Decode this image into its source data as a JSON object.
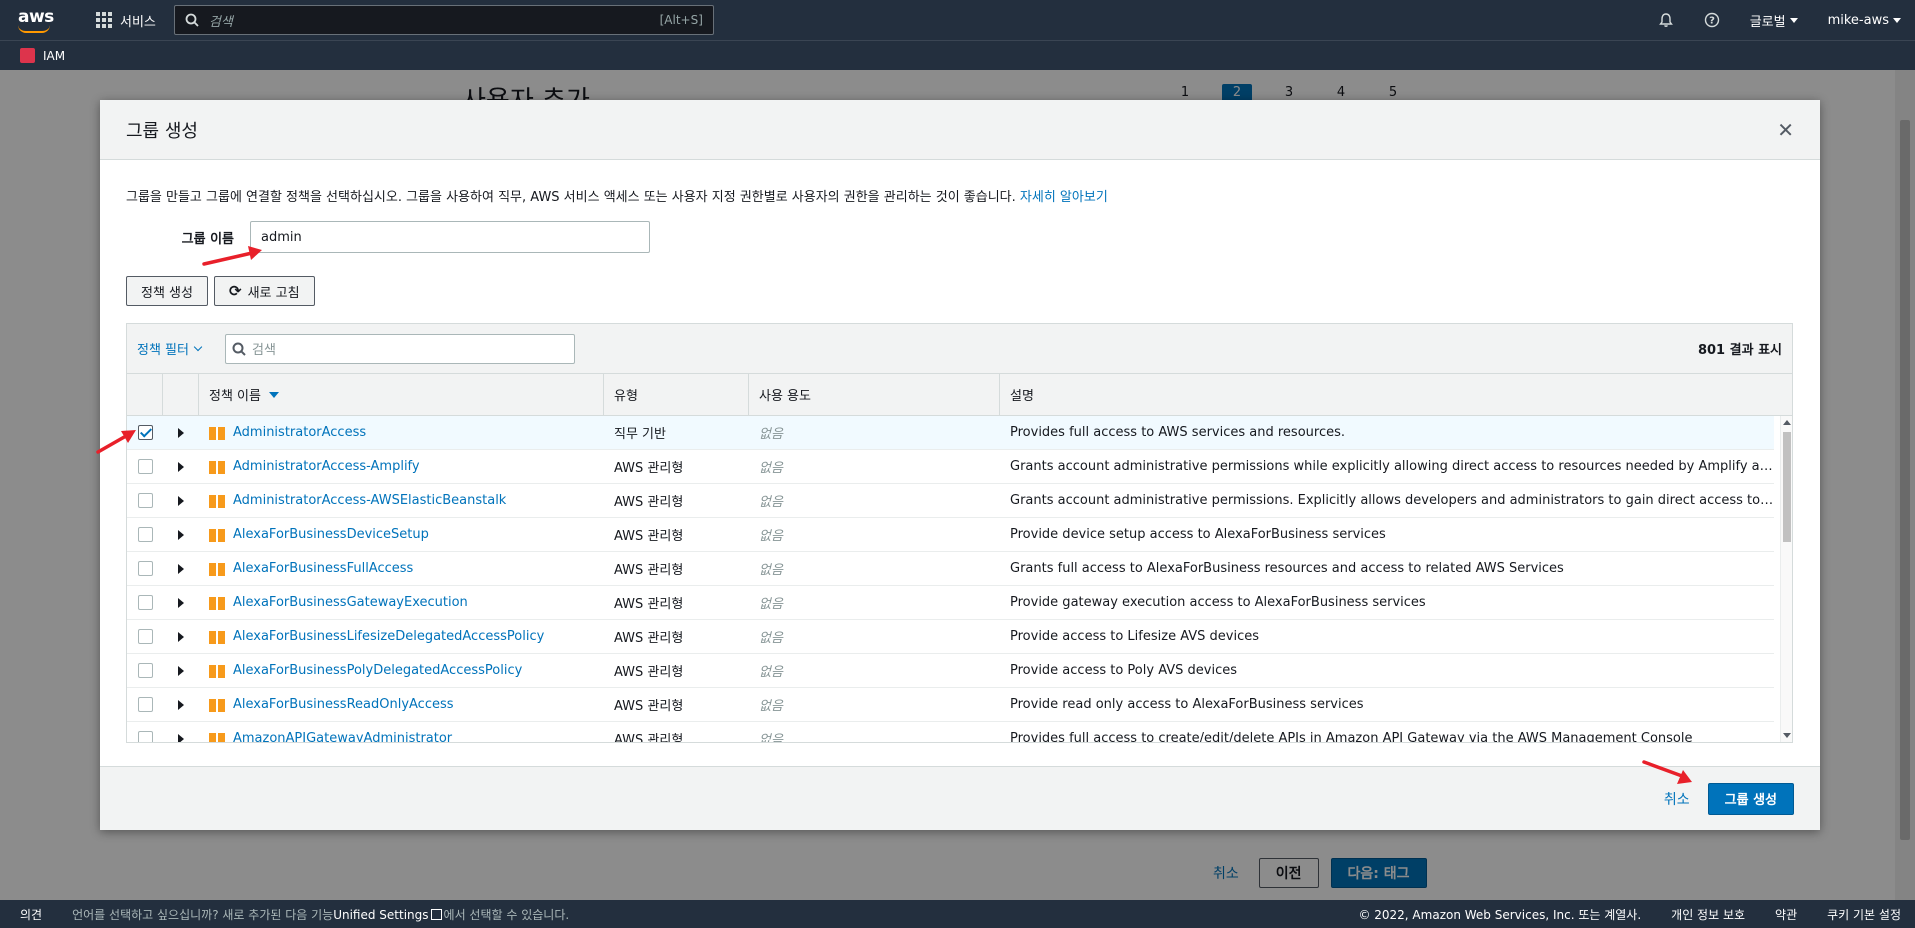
{
  "topnav": {
    "logo_text": "aws",
    "services_label": "서비스",
    "search_placeholder": "검색",
    "search_shortcut": "[Alt+S]",
    "region_label": "글로벌",
    "account_label": "mike-aws"
  },
  "subnav": {
    "service_name": "IAM"
  },
  "background": {
    "title": "사용자 추가",
    "steps": [
      "1",
      "2",
      "3",
      "4",
      "5"
    ],
    "active_step": "2",
    "cancel_label": "취소",
    "prev_label": "이전",
    "next_label": "다음: 태그"
  },
  "modal": {
    "title": "그룹 생성",
    "description": "그룹을 만들고 그룹에 연결할 정책을 선택하십시오. 그룹을 사용하여 직무, AWS 서비스 액세스 또는 사용자 지정 권한별로 사용자의 권한을 관리하는 것이 좋습니다.",
    "learn_more": "자세히 알아보기",
    "group_name_label": "그룹 이름",
    "group_name_value": "admin",
    "create_policy_label": "정책 생성",
    "refresh_label": "새로 고침",
    "filter_label": "정책 필터",
    "table_search_placeholder": "검색",
    "result_count": "801 결과 표시",
    "columns": {
      "name": "정책 이름",
      "type": "유형",
      "usage": "사용 용도",
      "description": "설명"
    },
    "rows": [
      {
        "name": "AdministratorAccess",
        "type": "직무 기반",
        "usage": "없음",
        "description": "Provides full access to AWS services and resources.",
        "checked": true
      },
      {
        "name": "AdministratorAccess-Amplify",
        "type": "AWS 관리형",
        "usage": "없음",
        "description": "Grants account administrative permissions while explicitly allowing direct access to resources needed by Amplify applications.",
        "checked": false
      },
      {
        "name": "AdministratorAccess-AWSElasticBeanstalk",
        "type": "AWS 관리형",
        "usage": "없음",
        "description": "Grants account administrative permissions. Explicitly allows developers and administrators to gain direct access to resources.",
        "checked": false
      },
      {
        "name": "AlexaForBusinessDeviceSetup",
        "type": "AWS 관리형",
        "usage": "없음",
        "description": "Provide device setup access to AlexaForBusiness services",
        "checked": false
      },
      {
        "name": "AlexaForBusinessFullAccess",
        "type": "AWS 관리형",
        "usage": "없음",
        "description": "Grants full access to AlexaForBusiness resources and access to related AWS Services",
        "checked": false
      },
      {
        "name": "AlexaForBusinessGatewayExecution",
        "type": "AWS 관리형",
        "usage": "없음",
        "description": "Provide gateway execution access to AlexaForBusiness services",
        "checked": false
      },
      {
        "name": "AlexaForBusinessLifesizeDelegatedAccessPolicy",
        "type": "AWS 관리형",
        "usage": "없음",
        "description": "Provide access to Lifesize AVS devices",
        "checked": false
      },
      {
        "name": "AlexaForBusinessPolyDelegatedAccessPolicy",
        "type": "AWS 관리형",
        "usage": "없음",
        "description": "Provide access to Poly AVS devices",
        "checked": false
      },
      {
        "name": "AlexaForBusinessReadOnlyAccess",
        "type": "AWS 관리형",
        "usage": "없음",
        "description": "Provide read only access to AlexaForBusiness services",
        "checked": false
      },
      {
        "name": "AmazonAPIGatewayAdministrator",
        "type": "AWS 관리형",
        "usage": "없음",
        "description": "Provides full access to create/edit/delete APIs in Amazon API Gateway via the AWS Management Console",
        "checked": false
      }
    ],
    "cancel_label": "취소",
    "create_group_label": "그룹 생성"
  },
  "footer": {
    "feedback": "의견",
    "message_before": "언어를 선택하고 싶으십니까? 새로 추가된 다음 기능",
    "message_link": "Unified Settings",
    "message_after": "에서 선택할 수 있습니다.",
    "copyright": "© 2022, Amazon Web Services, Inc. 또는 계열사.",
    "privacy": "개인 정보 보호",
    "terms": "약관",
    "cookies": "쿠키 기본 설정"
  },
  "colors": {
    "nav": "#232f3e",
    "accent": "#0073bb",
    "orange": "#ff9900",
    "annotation_arrow": "#e8202a"
  }
}
